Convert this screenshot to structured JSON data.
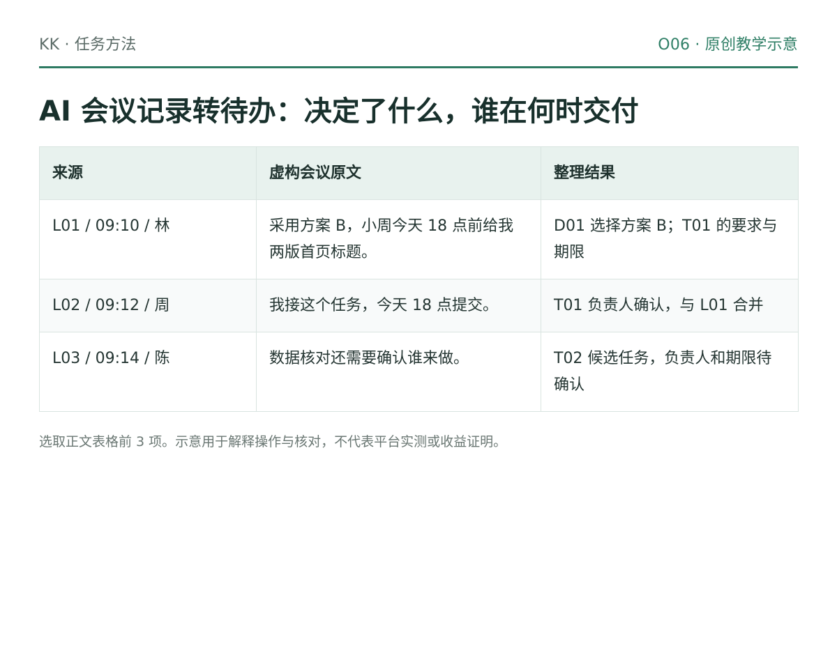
{
  "header": {
    "brand": "KK · 任务方法",
    "series": "O06 · 原创教学示意"
  },
  "title": "AI 会议记录转待办：决定了什么，谁在何时交付",
  "table": {
    "headers": [
      "来源",
      "虚构会议原文",
      "整理结果"
    ],
    "rows": [
      [
        "L01 / 09:10 / 林",
        "采用方案 B，小周今天 18 点前给我两版首页标题。",
        "D01 选择方案 B；T01 的要求与期限"
      ],
      [
        "L02 / 09:12 / 周",
        "我接这个任务，今天 18 点提交。",
        "T01 负责人确认，与 L01 合并"
      ],
      [
        "L03 / 09:14 / 陈",
        "数据核对还需要确认谁来做。",
        "T02 候选任务，负责人和期限待确认"
      ]
    ]
  },
  "footnote": "选取正文表格前 3 项。示意用于解释操作与核对，不代表平台实测或收益证明。",
  "colors": {
    "accent": "#2d7a62",
    "header_bg": "#e8f2ee"
  }
}
